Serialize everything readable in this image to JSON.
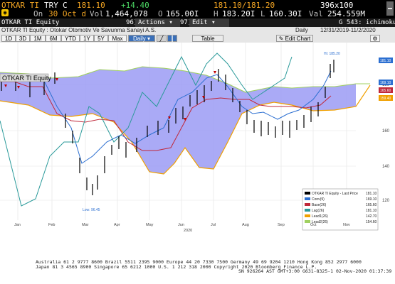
{
  "quote": {
    "ticker": "OTKAR TI",
    "currency": "TRY",
    "c_flag": "C",
    "last": "181.10",
    "change": "+14.40",
    "on_label": "On",
    "date": "30 Oct d",
    "vol_label": "Vol",
    "vol": "1,464,078",
    "o_label": "O",
    "open": "165.00I",
    "bid_ask": "181.10/181.20",
    "size": "396x100",
    "h_label": "H",
    "high": "183.20I",
    "l_label": "L",
    "low": "160.30I",
    "val_label": "Val",
    "val": "254.559M"
  },
  "menubar": {
    "security_name": "OTKAR TI Equity",
    "actions_num": "96)",
    "actions": "Actions",
    "edit_num": "97)",
    "edit": "Edit",
    "page_id": "G 543: ichimoku"
  },
  "titlebar": {
    "title": "OTKAR TI Equity : Otokar Otomotiv Ve Savunma Sanayi A.S.",
    "period": "Daily",
    "range": "12/31/2019-11/2/2020"
  },
  "toolbar": {
    "buttons": [
      "1D",
      "3D",
      "1M",
      "6M",
      "YTD",
      "1Y",
      "5Y",
      "Max"
    ],
    "period_select": "Daily",
    "table": "Table",
    "edit_chart": "Edit Chart"
  },
  "chart": {
    "title": "OTKAR TI Equity",
    "hi_label": "Hi: 185.20",
    "low_label": "Low: 96.45",
    "year_label": "2020",
    "months": [
      "Jan",
      "Feb",
      "Mar",
      "Apr",
      "May",
      "Jun",
      "Jul",
      "Aug",
      "Sep",
      "Oct",
      "Nov"
    ],
    "y_ticks": [
      "180",
      "160",
      "140",
      "120",
      "100"
    ],
    "right_tags": [
      "181.10",
      "169.10",
      "165.60",
      "159.40",
      "154.60"
    ],
    "colors": {
      "price_up": "#000000",
      "conv": "#2c6fd1",
      "base": "#c0283a",
      "lag": "#2a9a9a",
      "lead1": "#f0a000",
      "lead2": "#a0d060",
      "cloud": "#9b9bf5"
    },
    "legend": [
      {
        "name": "OTKAR TI Equity - Last Price",
        "value": "181.10"
      },
      {
        "name": "Conv(9)",
        "value": "169.10"
      },
      {
        "name": "Base(26)",
        "value": "165.60"
      },
      {
        "name": "Lag(26)",
        "value": "181.10"
      },
      {
        "name": "Lead1(26)",
        "value": "142.70"
      },
      {
        "name": "Lead2(26)",
        "value": "154.60"
      }
    ]
  },
  "footer": {
    "line1": "Australia 61 2 9777 8600 Brazil 5511 2395 9000 Europe 44 20 7330 7500 Germany 49 69 9204 1210 Hong Kong 852 2977 6000",
    "line2": "Japan 81 3 4565 8900 Singapore 65 6212 1000 U.S. 1 212 318 2000 Copyright 2020 Bloomberg Finance L.P.",
    "line3": "SN 926264 AST GMT+3:00 G631-8325-1 02-Nov-2020 01:37:39"
  }
}
